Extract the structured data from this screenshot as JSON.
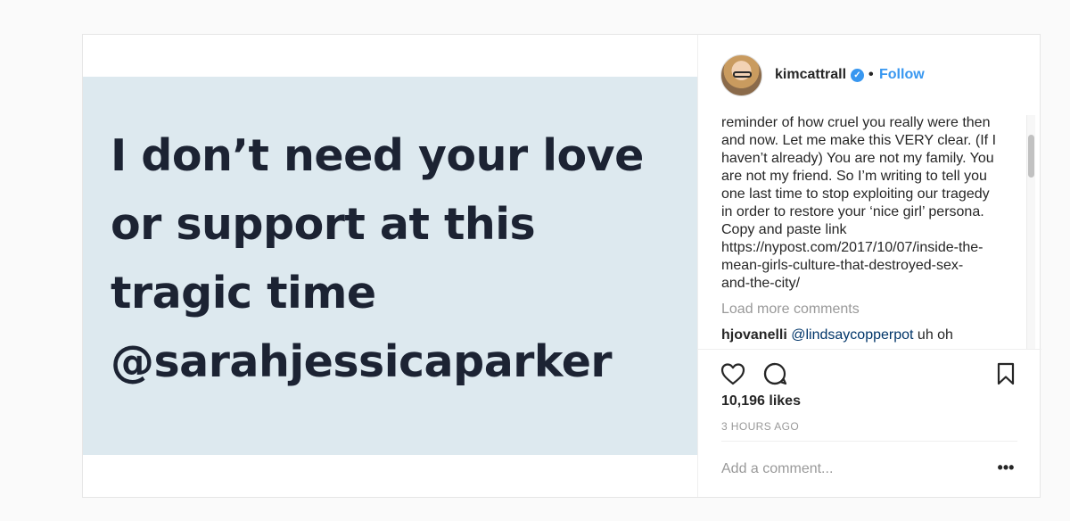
{
  "media": {
    "quote_lines": [
      "I don’t need your love",
      "or support at this",
      "tragic time",
      "@sarahjessicaparker"
    ],
    "background_color": "#dde9ef",
    "text_color": "#1c2333"
  },
  "header": {
    "username": "kimcattrall",
    "verified_icon": "verified-badge-icon",
    "separator": "•",
    "follow_label": "Follow"
  },
  "caption": {
    "lines": [
      "reminder of how cruel you really were then",
      "and now. Let me make this VERY clear. (If I",
      "haven’t already) You are not my family. You",
      "are not my friend. So I’m writing to tell you",
      "one last time to stop exploiting our tragedy",
      "in order to restore your ‘nice girl’ persona.",
      "Copy and paste link",
      "https://nypost.com/2017/10/07/inside-the-",
      "mean-girls-culture-that-destroyed-sex-",
      "and-the-city/"
    ]
  },
  "comments": {
    "load_more_label": "Load more comments",
    "items": [
      {
        "user": "hjovanelli",
        "mention": "@lindsaycopperpot",
        "text": " uh oh"
      }
    ]
  },
  "actions": {
    "like_icon": "heart-icon",
    "comment_icon": "speech-bubble-icon",
    "save_icon": "bookmark-icon"
  },
  "stats": {
    "likes": "10,196 likes",
    "timestamp": "3 HOURS AGO"
  },
  "add_comment": {
    "placeholder": "Add a comment...",
    "more_label": "•••"
  },
  "colors": {
    "accent": "#3897f0",
    "mention": "#003569",
    "muted": "#999999"
  }
}
